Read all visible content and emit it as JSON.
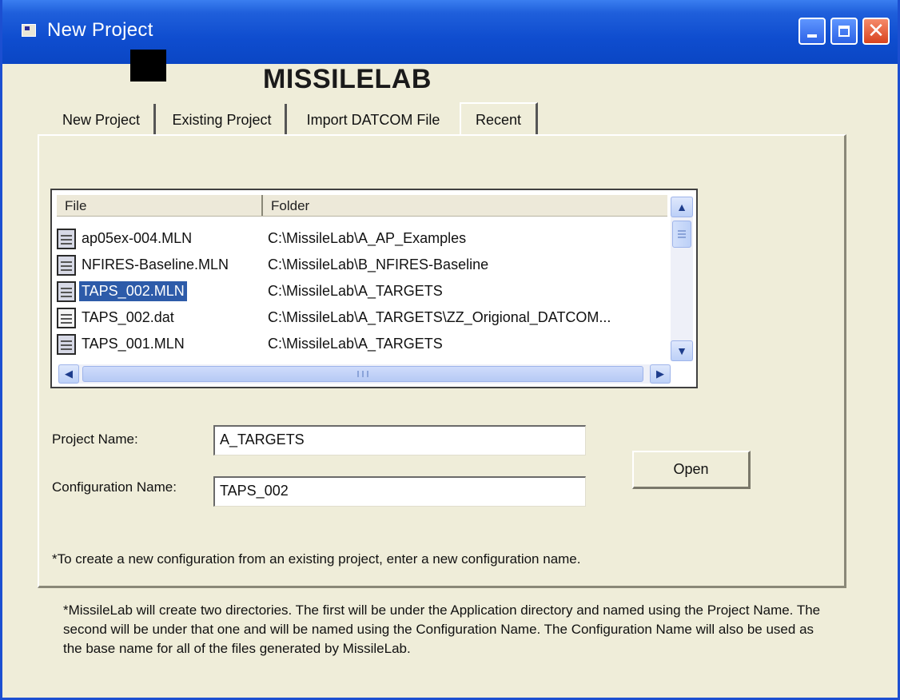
{
  "window": {
    "title": "New Project",
    "controls": {
      "minimize_icon": "minimize-icon",
      "maximize_icon": "maximize-icon",
      "close_icon": "close-icon",
      "close_glyph": "✕"
    },
    "titlebar_color": "#1f5fdb"
  },
  "header": {
    "app_title": "MISSILELAB"
  },
  "tabs": [
    {
      "label": "New Project",
      "active": false
    },
    {
      "label": "Existing Project",
      "active": false
    },
    {
      "label": "Import DATCOM File",
      "active": false
    },
    {
      "label": "Recent",
      "active": true
    }
  ],
  "file_list": {
    "columns": {
      "file": "File",
      "folder": "Folder"
    },
    "rows": [
      {
        "file": "ap05ex-004.MLN",
        "folder": "C:\\MissileLab\\A_AP_Examples",
        "icon": "mln-file-icon",
        "selected": false
      },
      {
        "file": "NFIRES-Baseline.MLN",
        "folder": "C:\\MissileLab\\B_NFIRES-Baseline",
        "icon": "mln-file-icon",
        "selected": false
      },
      {
        "file": "TAPS_002.MLN",
        "folder": "C:\\MissileLab\\A_TARGETS",
        "icon": "mln-file-icon",
        "selected": true
      },
      {
        "file": "TAPS_002.dat",
        "folder": "C:\\MissileLab\\A_TARGETS\\ZZ_Origional_DATCOM...",
        "icon": "dat-file-icon",
        "selected": false
      },
      {
        "file": "TAPS_001.MLN",
        "folder": "C:\\MissileLab\\A_TARGETS",
        "icon": "mln-file-icon",
        "selected": false
      }
    ],
    "selection_color": "#2d5ba9",
    "scroll_glyphs": {
      "up": "▲",
      "down": "▼",
      "left": "◀",
      "right": "▶"
    }
  },
  "form": {
    "project_label": "Project Name:",
    "project_value": "A_TARGETS",
    "config_label": "Configuration Name:",
    "config_value": "TAPS_002",
    "open_label": "Open",
    "note": "*To create a new configuration from an existing project, enter a new configuration name."
  },
  "footer_note": "*MissileLab will create two directories.  The first will be under the Application directory and named using the Project Name.  The second will be under that one and will be named using the Configuration Name.  The Configuration Name will also be used as the base name for all of the files generated by MissileLab."
}
